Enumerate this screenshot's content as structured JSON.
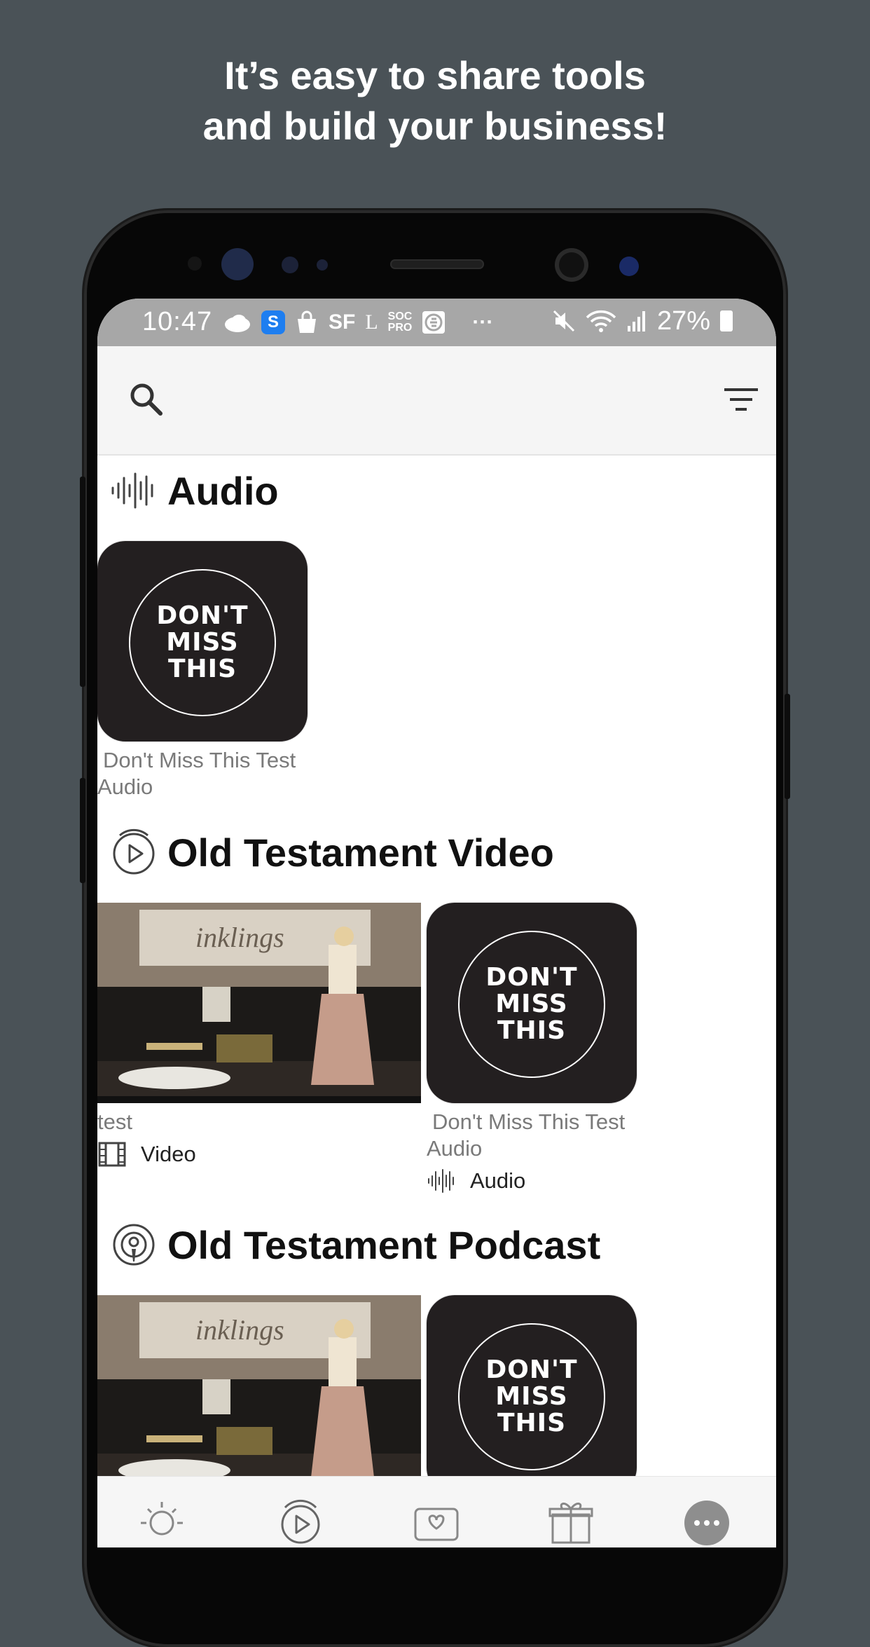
{
  "headline": {
    "line1": "It’s easy to share tools",
    "line2": "and build your business!"
  },
  "status_bar": {
    "time": "10:47",
    "left_icons": [
      "cloud-icon",
      "s-app-icon",
      "shopping-bag-icon",
      "sf-icon",
      "l-icon",
      "soc-pro-icon",
      "e-icon",
      "more-dots-icon"
    ],
    "right_icons": [
      "mute-icon",
      "wifi-icon",
      "signal-icon",
      "battery-icon"
    ],
    "sf_label": "SF",
    "l_label": "L",
    "soc_label": "SOC",
    "pro_label": "PRO",
    "dots_label": "···",
    "battery": "27%"
  },
  "appbar": {
    "search_icon": "search-icon",
    "filter_icon": "filter-icon"
  },
  "sections": {
    "audio": {
      "title": "Audio",
      "icon": "audio-wave-icon",
      "items": [
        {
          "art": [
            "DON'T",
            "MISS",
            "THIS"
          ],
          "title_line1": "Don't Miss This Test",
          "title_line2": "Audio"
        }
      ]
    },
    "video": {
      "title": "Old Testament Video",
      "icon": "play-circle-icon",
      "items": [
        {
          "banner": "inklings",
          "title_line1": "test",
          "type_label": "Video",
          "type_icon": "film-icon"
        },
        {
          "art": [
            "DON'T",
            "MISS",
            "THIS"
          ],
          "title_line1": "Don't Miss This Test",
          "title_line2": "Audio",
          "type_label": "Audio",
          "type_icon": "audio-wave-icon"
        }
      ]
    },
    "podcast": {
      "title": "Old Testament Podcast",
      "icon": "podcast-icon",
      "items": [
        {
          "banner": "inklings"
        },
        {
          "art": [
            "DON'T",
            "MISS",
            "THIS"
          ]
        }
      ]
    }
  },
  "bottom_nav": {
    "items": [
      "sun-icon",
      "play-circle-icon",
      "chat-heart-icon",
      "gift-icon",
      "more-icon"
    ]
  },
  "colors": {
    "background": "#4a5257",
    "status_bar": "#a7a7a7",
    "app_bar": "#f5f5f5",
    "dark_tile": "#231f20"
  }
}
